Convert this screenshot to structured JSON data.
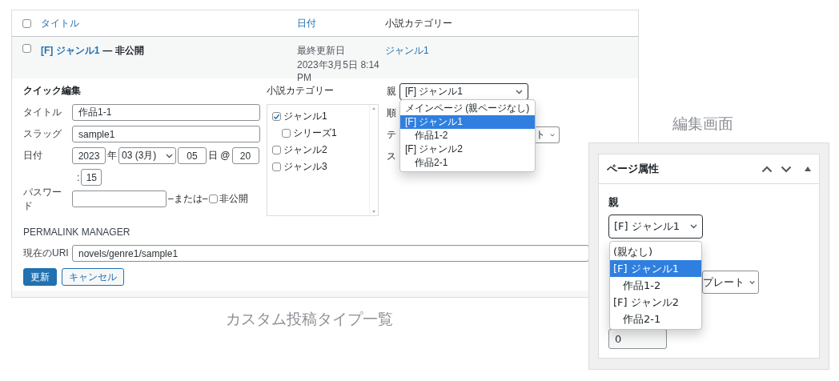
{
  "list_window": {
    "header": {
      "checked": false,
      "columns": [
        "タイトル",
        "日付",
        "小説カテゴリー"
      ]
    },
    "row": {
      "checked": false,
      "title": "[F] ジャンル1",
      "state": "— 非公開",
      "date_label": "最終更新日",
      "date": "2023年3月5日 8:14 PM",
      "category": "ジャンル1"
    },
    "quick_edit": {
      "heading": "クイック編集",
      "fields": [
        {
          "label": "タイトル",
          "value": "作品1-1"
        },
        {
          "label": "スラッグ",
          "value": "sample1"
        }
      ],
      "date": {
        "label": "日付",
        "year": "2023",
        "year_unit": "年",
        "month": "03 (3月)",
        "day": "05",
        "day_unit": "日 @",
        "hour": "20",
        "colon": ":",
        "minute": "15"
      },
      "password": {
        "label": "パスワード",
        "or": "–または–",
        "private_label": "非公開",
        "private_checked": false
      },
      "category_box": {
        "label": "小説カテゴリー",
        "items": [
          {
            "label": "ジャンル1",
            "checked": true,
            "children": [
              {
                "label": "シリーズ1",
                "checked": false
              }
            ]
          },
          {
            "label": "ジャンル2",
            "checked": false
          },
          {
            "label": "ジャンル3",
            "checked": false
          }
        ]
      },
      "parent": {
        "label": "親",
        "value": "[F] ジャンル1",
        "options": [
          {
            "label": "メインページ (親ページなし)",
            "selected": false
          },
          {
            "label": "[F] ジャンル1",
            "selected": true,
            "children": [
              {
                "label": "作品1-2",
                "selected": false
              }
            ]
          },
          {
            "label": "[F] ジャンル2",
            "selected": false,
            "children": [
              {
                "label": "作品2-1",
                "selected": false
              }
            ]
          }
        ]
      },
      "covered_labels": [
        "順",
        "テ",
        "ス"
      ],
      "template_fragment": "ト",
      "permalink": {
        "heading": "PERMALINK MANAGER",
        "label": "現在のURI",
        "value": "novels/genre1/sample1"
      },
      "buttons": [
        {
          "label": "更新",
          "kind": "primary"
        },
        {
          "label": "キャンセル",
          "kind": "secondary"
        }
      ]
    }
  },
  "list_caption": "カスタム投稿タイプ一覧",
  "edit_caption": "編集画面",
  "edit_window": {
    "panel_title": "ページ属性",
    "parent_label": "親",
    "parent_value": "[F] ジャンル1",
    "options": [
      {
        "label": "(親なし)",
        "selected": false
      },
      {
        "label": "[F] ジャンル1",
        "selected": true,
        "children": [
          {
            "label": "作品1-2",
            "selected": false
          }
        ]
      },
      {
        "label": "[F] ジャンル2",
        "selected": false,
        "children": [
          {
            "label": "作品2-1",
            "selected": false
          }
        ]
      }
    ],
    "template_fragment": "プレート",
    "order_value": "0"
  }
}
